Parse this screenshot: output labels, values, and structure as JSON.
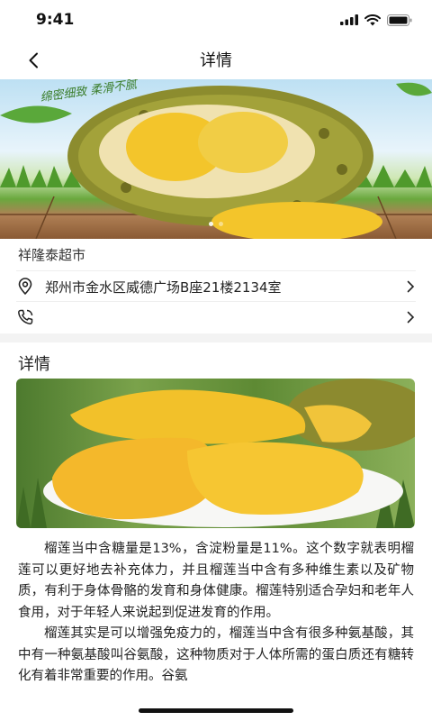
{
  "status_bar": {
    "time": "9:41"
  },
  "nav": {
    "title": "详情"
  },
  "banner": {
    "slogan": "绵密细致 柔滑不腻",
    "slide_count": 2,
    "active_slide": 1
  },
  "store": {
    "name": "祥隆泰超市",
    "address": "郑州市金水区威德广场B座21楼2134室",
    "phone": ""
  },
  "details": {
    "heading": "详情",
    "paragraphs": [
      "榴莲当中含糖量是13%，含淀粉量是11%。这个数字就表明榴莲可以更好地去补充体力，并且榴莲当中含有多种维生素以及矿物质，有利于身体骨骼的发育和身体健康。榴莲特别适合孕妇和老年人食用，对于年轻人来说起到促进发育的作用。",
      "榴莲其实是可以增强免疫力的，榴莲当中含有很多种氨基酸，其中有一种氨基酸叫谷氨酸，这种物质对于人体所需的蛋白质还有糖转化有着非常重要的作用。谷氨"
    ]
  },
  "colors": {
    "fruit_yellow": "#f3c52b",
    "husk_green": "#8a8a2c",
    "accent_text": "#222222"
  }
}
